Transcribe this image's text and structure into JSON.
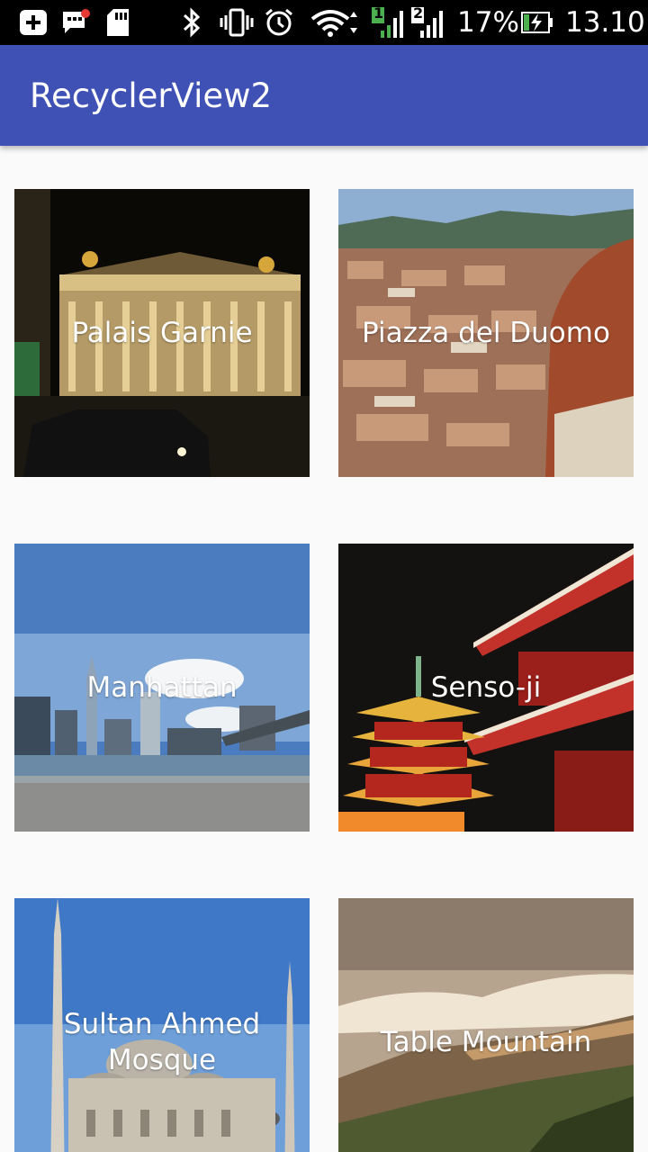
{
  "status_bar": {
    "icons": [
      "add-box-icon",
      "chat-bubble-icon",
      "sd-card-icon",
      "bluetooth-icon",
      "vibrate-icon",
      "alarm-icon",
      "wifi-icon",
      "signal-sim1-icon",
      "signal-sim2-icon",
      "battery-charging-icon"
    ],
    "sim1_label": "1",
    "sim2_label": "2",
    "battery_percent": "17%",
    "time": "13.10"
  },
  "app_bar": {
    "title": "RecyclerView2",
    "color": "#3f51b5"
  },
  "places": [
    {
      "name": "Palais Garnie"
    },
    {
      "name": "Piazza del Duomo"
    },
    {
      "name": "Manhattan"
    },
    {
      "name": "Senso-ji"
    },
    {
      "name": "Sultan Ahmed Mosque"
    },
    {
      "name": "Table Mountain"
    }
  ]
}
